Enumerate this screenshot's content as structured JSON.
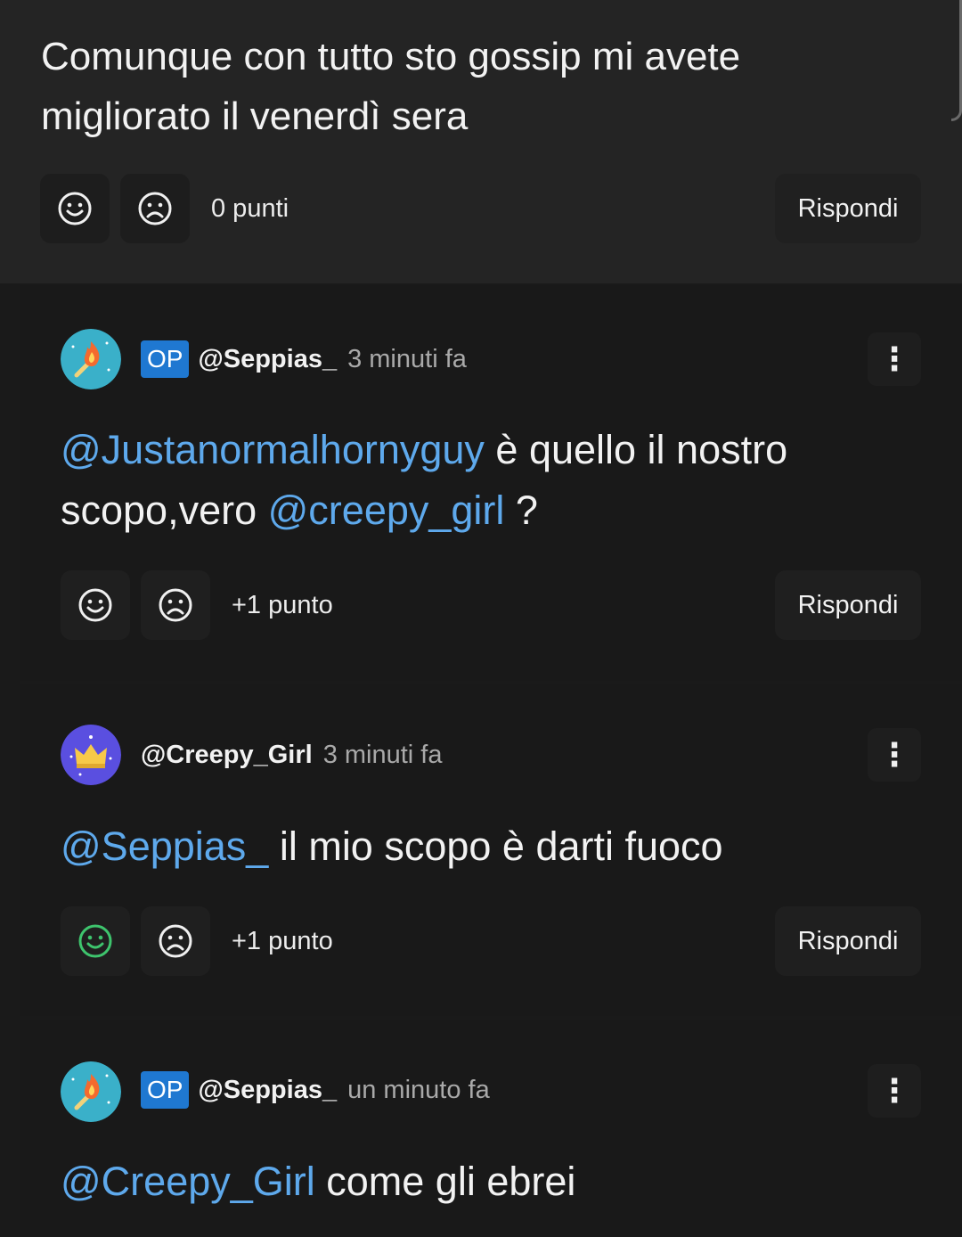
{
  "top": {
    "text": "Comunque con tutto sto gossip mi avete migliorato il venerdì sera",
    "points": "0 punti",
    "reply_label": "Rispondi",
    "upvote_icon": "smile-icon",
    "downvote_icon": "frown-icon"
  },
  "comments": [
    {
      "op_badge": "OP",
      "username": "@Seppias_",
      "time": "3 minuti fa",
      "mention1": "@Justanormalhornyguy",
      "text1": " è quello il nostro scopo,vero ",
      "mention2": "@creepy_girl",
      "text2": " ?",
      "points": "+1 punto",
      "reply_label": "Rispondi",
      "avatar_icon": "match-flame-avatar",
      "more_icon": "⋮"
    },
    {
      "username": "@Creepy_Girl",
      "time": "3 minuti fa",
      "mention1": "@Seppias_",
      "text1": " il mio scopo è darti fuoco",
      "points": "+1 punto",
      "reply_label": "Rispondi",
      "upvote_active": true,
      "avatar_icon": "crown-avatar",
      "more_icon": "⋮"
    },
    {
      "op_badge": "OP",
      "username": "@Seppias_",
      "time": "un minuto fa",
      "mention1": "@Creepy_Girl",
      "text1": " come gli ebrei",
      "avatar_icon": "match-flame-avatar",
      "more_icon": "⋮"
    }
  ],
  "colors": {
    "mention": "#5ea9ec",
    "op_badge": "#1f78d1",
    "upvote_active": "#3ec46d",
    "avatar_match_bg": "#3ab0c9",
    "avatar_crown_bg": "#5a4fe0"
  }
}
